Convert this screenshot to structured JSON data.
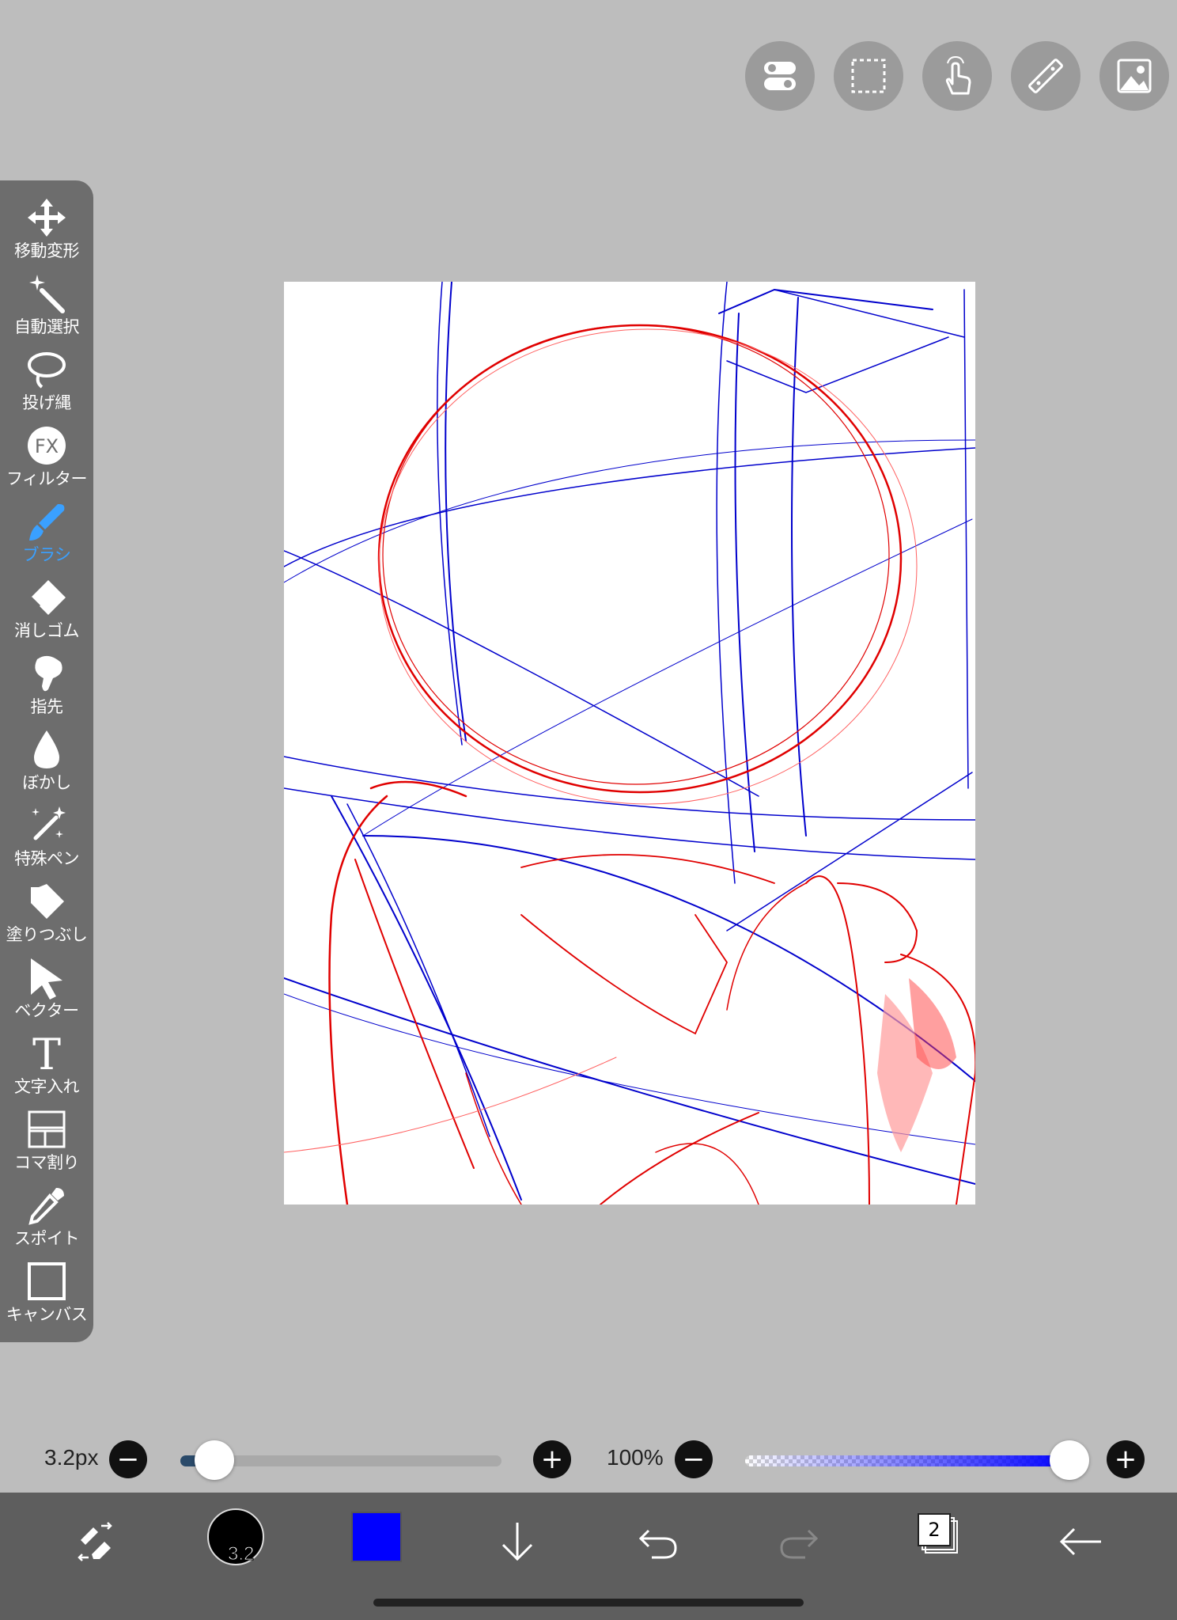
{
  "top_toolbar": {
    "buttons": [
      {
        "icon": "toggle-settings-icon"
      },
      {
        "icon": "selection-rect-icon"
      },
      {
        "icon": "touch-gesture-icon"
      },
      {
        "icon": "ruler-icon"
      },
      {
        "icon": "image-material-icon"
      }
    ]
  },
  "tools": [
    {
      "key": "move",
      "label": "移動変形",
      "icon": "move-icon"
    },
    {
      "key": "magic",
      "label": "自動選択",
      "icon": "magic-wand-icon"
    },
    {
      "key": "lasso",
      "label": "投げ縄",
      "icon": "lasso-icon"
    },
    {
      "key": "filter",
      "label": "フィルター",
      "icon": "fx-icon",
      "icon_text": "FX"
    },
    {
      "key": "brush",
      "label": "ブラシ",
      "icon": "brush-icon",
      "active": true
    },
    {
      "key": "eraser",
      "label": "消しゴム",
      "icon": "eraser-icon"
    },
    {
      "key": "finger",
      "label": "指先",
      "icon": "smudge-icon"
    },
    {
      "key": "blur",
      "label": "ぼかし",
      "icon": "blur-drop-icon"
    },
    {
      "key": "special",
      "label": "特殊ペン",
      "icon": "special-pen-icon"
    },
    {
      "key": "fill",
      "label": "塗りつぶし",
      "icon": "fill-bucket-icon"
    },
    {
      "key": "vector",
      "label": "ベクター",
      "icon": "vector-arrow-icon"
    },
    {
      "key": "text",
      "label": "文字入れ",
      "icon": "text-icon",
      "icon_text": "T"
    },
    {
      "key": "frame",
      "label": "コマ割り",
      "icon": "frame-divider-icon"
    },
    {
      "key": "eyedropper",
      "label": "スポイト",
      "icon": "eyedropper-icon"
    },
    {
      "key": "canvas",
      "label": "キャンバス",
      "icon": "canvas-icon"
    }
  ],
  "sliders": {
    "brush_size_label": "3.2px",
    "brush_size_fraction": 0.02,
    "opacity_label": "100%",
    "opacity_fraction": 1.0,
    "minus_glyph": "−",
    "plus_glyph": "+"
  },
  "bottom_bar": {
    "brush_size_text": "3.2",
    "current_color": "#0000ff",
    "layer_count": "2",
    "icons": [
      "swap-tool-icon",
      "brush-preview",
      "color-swatch",
      "download-arrow-icon",
      "undo-icon",
      "redo-icon",
      "layers-icon",
      "back-arrow-icon"
    ]
  },
  "colors": {
    "background": "#bdbdbd",
    "panel": "#6d6d6d",
    "active_tool": "#3aa0ff",
    "sketch_red": "#e00000",
    "sketch_blue": "#0000cc"
  }
}
